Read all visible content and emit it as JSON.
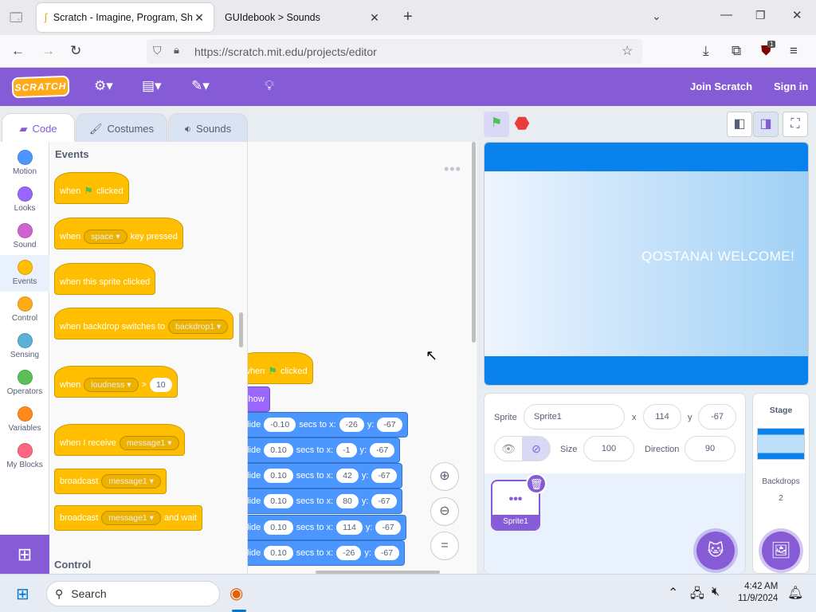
{
  "browser": {
    "tabs": [
      {
        "title": "Scratch - Imagine, Program, Sh",
        "close": "✕"
      },
      {
        "title": "GUIdebook > Sounds",
        "close": "✕"
      }
    ],
    "new_tab": "+",
    "url_host": "https://scratch.mit.edu",
    "url_path": "/projects/editor",
    "extension_badge": "1"
  },
  "menubar": {
    "logo": "SCRATCH",
    "join": "Join Scratch",
    "signin": "Sign in"
  },
  "editor_tabs": {
    "code": "Code",
    "costumes": "Costumes",
    "sounds": "Sounds"
  },
  "categories": [
    {
      "label": "Motion",
      "color": "#4c97ff"
    },
    {
      "label": "Looks",
      "color": "#9966ff"
    },
    {
      "label": "Sound",
      "color": "#cf63cf"
    },
    {
      "label": "Events",
      "color": "#ffbf00"
    },
    {
      "label": "Control",
      "color": "#ffab19"
    },
    {
      "label": "Sensing",
      "color": "#5cb1d6"
    },
    {
      "label": "Operators",
      "color": "#59c059"
    },
    {
      "label": "Variables",
      "color": "#ff8c1a"
    },
    {
      "label": "My Blocks",
      "color": "#ff6680"
    }
  ],
  "palette": {
    "section_events": "Events",
    "section_control": "Control",
    "when": "when",
    "clicked": "clicked",
    "key_pressed": "key pressed",
    "space": "space",
    "sprite_clicked": "when this sprite clicked",
    "backdrop_switches": "when backdrop switches to",
    "backdrop1": "backdrop1",
    "loudness": "loudness",
    "gt": ">",
    "loud_val": "10",
    "receive": "when I receive",
    "message1": "message1",
    "broadcast": "broadcast",
    "and_wait": "and wait"
  },
  "script": {
    "hat_when": "when",
    "hat_clicked": "clicked",
    "show": "show",
    "glide": "glide",
    "secs_to_x": "secs to x:",
    "y": "y:",
    "glides": [
      {
        "secs": "-0.10",
        "x": "-26",
        "y": "-67"
      },
      {
        "secs": "0.10",
        "x": "-1",
        "y": "-67"
      },
      {
        "secs": "0.10",
        "x": "42",
        "y": "-67"
      },
      {
        "secs": "0.10",
        "x": "80",
        "y": "-67"
      },
      {
        "secs": "0.10",
        "x": "114",
        "y": "-67"
      },
      {
        "secs": "0.10",
        "x": "-26",
        "y": "-67"
      }
    ]
  },
  "stage": {
    "text": "QOSTANAI WELCOME!"
  },
  "sprite_info": {
    "sprite_label": "Sprite",
    "sprite_name": "Sprite1",
    "x_label": "x",
    "x": "114",
    "y_label": "y",
    "y": "-67",
    "show_label": "Show",
    "size_label": "Size",
    "size": "100",
    "direction_label": "Direction",
    "direction": "90",
    "sprite_thumb": "Sprite1"
  },
  "stage_pane": {
    "title": "Stage",
    "backdrops_label": "Backdrops",
    "backdrops_count": "2"
  },
  "taskbar": {
    "search": "Search",
    "time": "4:42 AM",
    "date": "11/9/2024"
  }
}
